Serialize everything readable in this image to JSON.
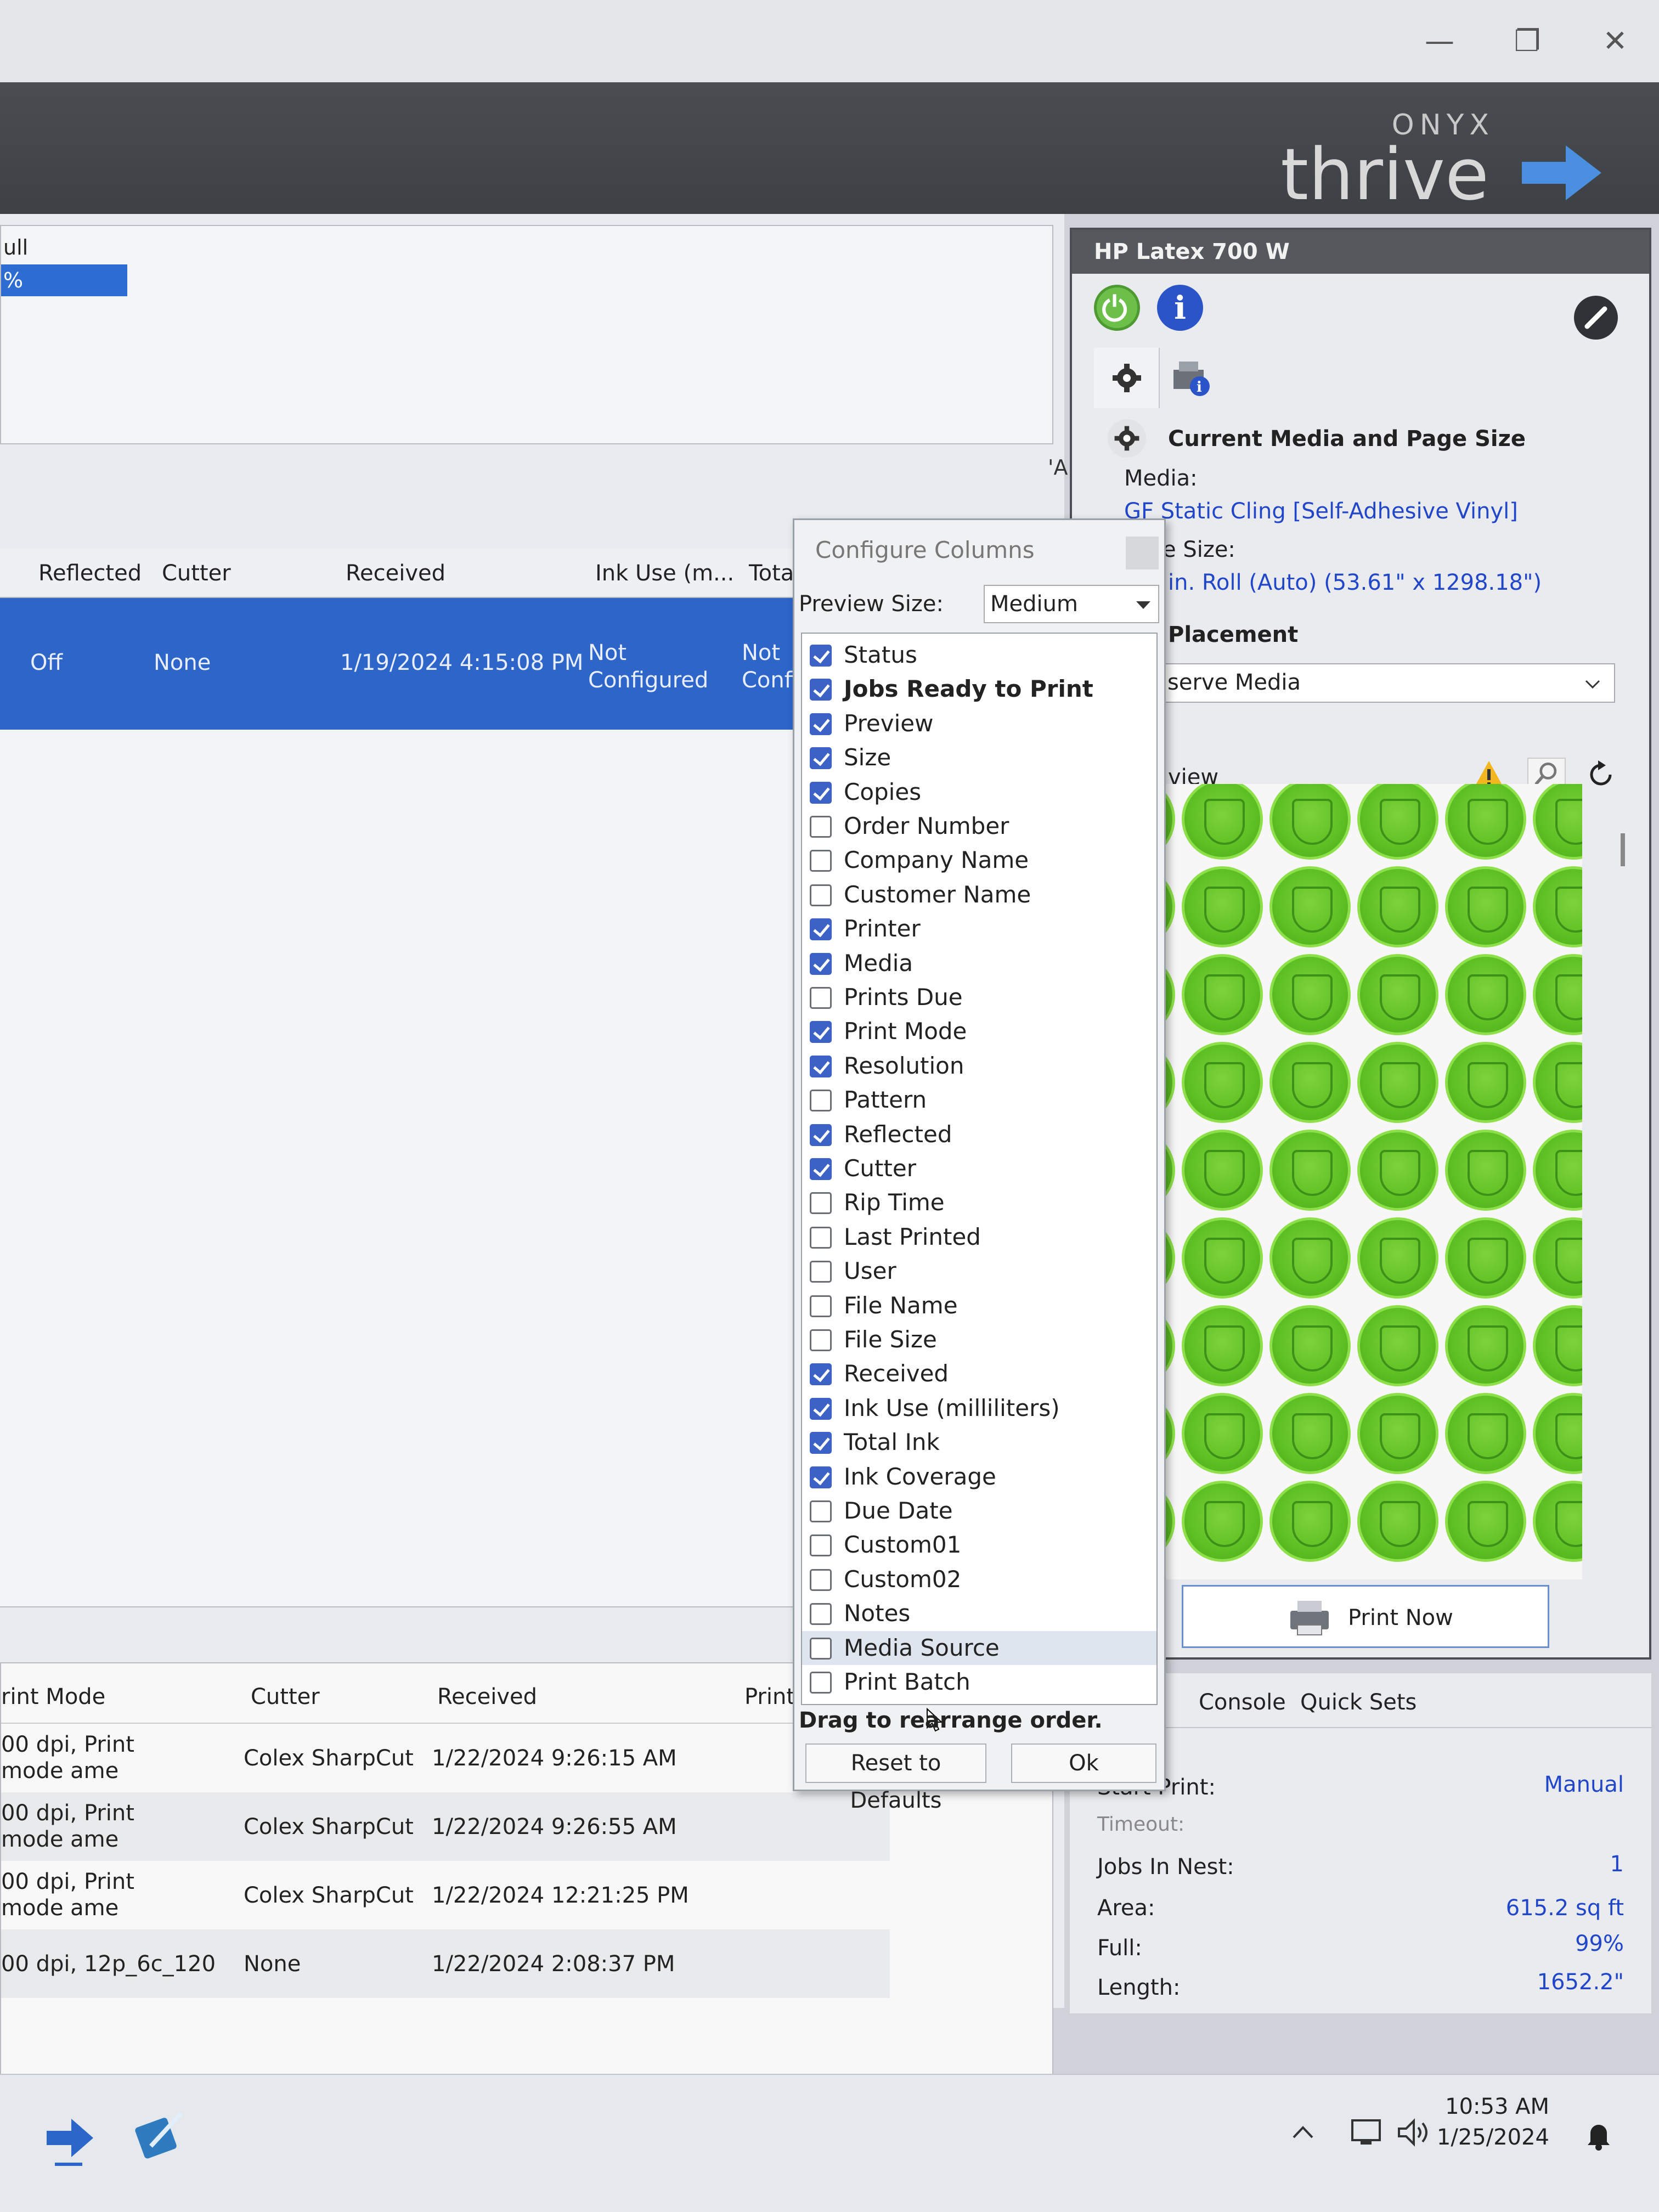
{
  "window": {
    "minimize": "—",
    "maximize": "❐",
    "close": "✕"
  },
  "brand": {
    "top": "ONYX",
    "name": "thrive"
  },
  "top_panel": {
    "row1": "ull",
    "row2": "%"
  },
  "a_label": "'A",
  "queue_table": {
    "columns": [
      "Reflected",
      "Cutter",
      "Received",
      "Ink Use (m...",
      "Total"
    ],
    "selected_row": {
      "reflected": "Off",
      "cutter": "None",
      "received": "1/19/2024 4:15:08 PM",
      "ink_use": "Not Configured",
      "total": "Not Confi"
    }
  },
  "printed_table": {
    "columns": [
      "rint Mode",
      "Cutter",
      "Received",
      "Print"
    ],
    "rows": [
      {
        "print_mode": "00 dpi, Print mode ame",
        "cutter": "Colex SharpCut",
        "received": "1/22/2024 9:26:15 AM"
      },
      {
        "print_mode": "00 dpi, Print mode ame",
        "cutter": "Colex SharpCut",
        "received": "1/22/2024 9:26:55 AM"
      },
      {
        "print_mode": "00 dpi, Print mode ame",
        "cutter": "Colex SharpCut",
        "received": "1/22/2024 12:21:25 PM"
      },
      {
        "print_mode": "00 dpi, 12p_6c_120",
        "cutter": "None",
        "received": "1/22/2024 2:08:37 PM"
      }
    ]
  },
  "printer": {
    "name": "HP Latex 700 W",
    "section_title": "Current Media and Page Size",
    "media_label": "Media:",
    "media_value": "GF Static Cling [Self-Adhesive Vinyl]",
    "size_label": "e Size:",
    "size_value": "in. Roll (Auto) (53.61\" x 1298.18\")",
    "placement_label": "Placement",
    "placement_value": "serve Media",
    "preview_label": "view",
    "print_now": "Print Now"
  },
  "tabs": [
    "p",
    "Console",
    "Quick Sets"
  ],
  "info": {
    "start_print_label": "Start Print:",
    "start_print_value": "Manual",
    "timeout_label": "Timeout:",
    "jobs_in_nest_label": "Jobs In Nest:",
    "jobs_in_nest_value": "1",
    "area_label": "Area:",
    "area_value": "615.2 sq ft",
    "full_label": "Full:",
    "full_value": "99%",
    "length_label": "Length:",
    "length_value": "1652.2\""
  },
  "dialog": {
    "title": "Configure Columns",
    "preview_size_label": "Preview Size:",
    "preview_size_value": "Medium",
    "columns": [
      {
        "name": "Status",
        "checked": true
      },
      {
        "name": "Jobs Ready to Print",
        "checked": true,
        "bold": true
      },
      {
        "name": "Preview",
        "checked": true
      },
      {
        "name": "Size",
        "checked": true
      },
      {
        "name": "Copies",
        "checked": true
      },
      {
        "name": "Order Number",
        "checked": false
      },
      {
        "name": "Company Name",
        "checked": false
      },
      {
        "name": "Customer Name",
        "checked": false
      },
      {
        "name": "Printer",
        "checked": true
      },
      {
        "name": "Media",
        "checked": true
      },
      {
        "name": "Prints Due",
        "checked": false
      },
      {
        "name": "Print Mode",
        "checked": true
      },
      {
        "name": "Resolution",
        "checked": true
      },
      {
        "name": "Pattern",
        "checked": false
      },
      {
        "name": "Reflected",
        "checked": true
      },
      {
        "name": "Cutter",
        "checked": true
      },
      {
        "name": "Rip Time",
        "checked": false
      },
      {
        "name": "Last Printed",
        "checked": false
      },
      {
        "name": "User",
        "checked": false
      },
      {
        "name": "File Name",
        "checked": false
      },
      {
        "name": "File Size",
        "checked": false
      },
      {
        "name": "Received",
        "checked": true
      },
      {
        "name": "Ink Use (milliliters)",
        "checked": true
      },
      {
        "name": "Total Ink",
        "checked": true
      },
      {
        "name": "Ink Coverage",
        "checked": true
      },
      {
        "name": "Due Date",
        "checked": false
      },
      {
        "name": "Custom01",
        "checked": false
      },
      {
        "name": "Custom02",
        "checked": false
      },
      {
        "name": "Notes",
        "checked": false
      },
      {
        "name": "Media Source",
        "checked": false,
        "highlight": true
      },
      {
        "name": "Print Batch",
        "checked": false
      }
    ],
    "hint": "Drag to rearrange order.",
    "reset_button": "Reset to Defaults",
    "ok_button": "Ok"
  },
  "taskbar": {
    "time": "10:53 AM",
    "date": "1/25/2024"
  },
  "colors": {
    "selection": "#2d65c8",
    "accent": "#2146c8",
    "sticker_green": "#5cbf22",
    "header": "#45484d"
  }
}
